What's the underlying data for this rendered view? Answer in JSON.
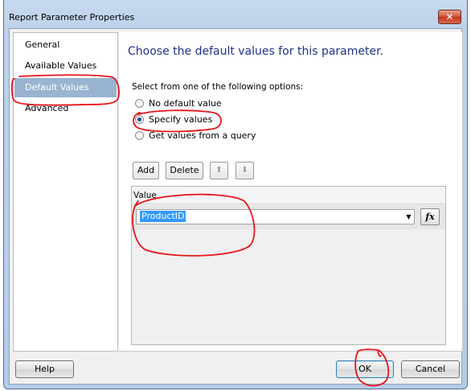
{
  "window": {
    "title": "Report Parameter Properties",
    "close_glyph": "✕"
  },
  "nav": {
    "items": [
      {
        "label": "General",
        "selected": false
      },
      {
        "label": "Available Values",
        "selected": false
      },
      {
        "label": "Default Values",
        "selected": true
      },
      {
        "label": "Advanced",
        "selected": false
      }
    ]
  },
  "content": {
    "heading": "Choose the default values for this parameter.",
    "options_label": "Select from one of the following options:",
    "options": [
      {
        "label": "No default value",
        "checked": false
      },
      {
        "label": "Specify values",
        "checked": true
      },
      {
        "label": "Get values from a query",
        "checked": false
      }
    ],
    "toolbar": {
      "add_label": "Add",
      "delete_label": "Delete",
      "move_up_glyph": "⬆",
      "move_down_glyph": "⬇"
    },
    "grid": {
      "header": "Value",
      "rows": [
        {
          "value": "ProductID"
        }
      ],
      "dropdown_glyph": "▼",
      "expression_label": "fx"
    }
  },
  "footer": {
    "help_label": "Help",
    "ok_label": "OK",
    "cancel_label": "Cancel"
  },
  "colors": {
    "annotation": "#e8141c",
    "selection": "#3399ff",
    "nav_selected": "#99b4d1",
    "heading": "#1e3287"
  }
}
